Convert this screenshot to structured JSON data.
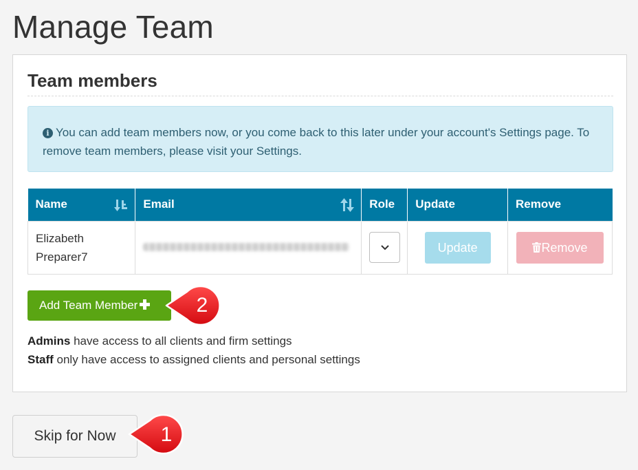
{
  "page": {
    "title": "Manage Team"
  },
  "section": {
    "title": "Team members"
  },
  "info": {
    "icon": "info-circle-icon",
    "text": "You can add team members now, or you come back to this later under your account's Settings page. To remove team members, please visit your Settings."
  },
  "table": {
    "headers": {
      "name": "Name",
      "email": "Email",
      "role": "Role",
      "update": "Update",
      "remove": "Remove"
    },
    "rows": [
      {
        "name_first": "Elizabeth",
        "name_last": "Preparer7",
        "email": "",
        "role": "",
        "update_label": "Update",
        "remove_label": "Remove"
      }
    ]
  },
  "actions": {
    "add_member_label": "Add Team Member",
    "skip_label": "Skip for Now"
  },
  "legend": {
    "admins_term": "Admins",
    "admins_desc": " have access to all clients and firm settings",
    "staff_term": "Staff",
    "staff_desc": " only have access to assigned clients and personal settings"
  },
  "callouts": [
    {
      "number": "1"
    },
    {
      "number": "2"
    }
  ],
  "colors": {
    "header_bg": "#0079a3",
    "info_bg": "#d6eef6",
    "add_button": "#5aa513",
    "update_button": "#a6dcec",
    "remove_button": "#f2b2b9",
    "callout": "#e8101a"
  }
}
